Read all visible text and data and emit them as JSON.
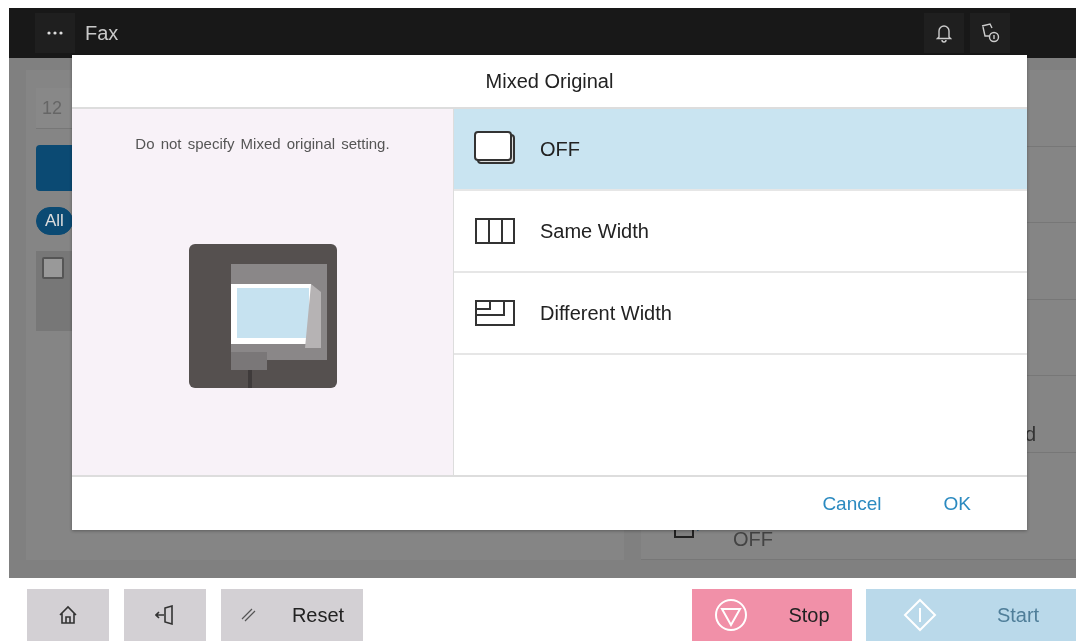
{
  "top_bar": {
    "title": "Fax"
  },
  "background": {
    "address_field": {
      "value": "12"
    },
    "filter_chip": {
      "label": "All",
      "selected": true
    },
    "list_checkbox": {
      "checked": false
    },
    "setting_tail": {
      "text": "d"
    },
    "setting_value": {
      "text": "OFF"
    }
  },
  "dialog": {
    "title": "Mixed Original",
    "description": "Do not specify Mixed original setting.",
    "options": [
      {
        "kind": "off",
        "label": "OFF",
        "selected": true
      },
      {
        "kind": "same",
        "label": "Same Width",
        "selected": false
      },
      {
        "kind": "different",
        "label": "Different Width",
        "selected": false
      }
    ],
    "buttons": [
      {
        "label": "Cancel"
      },
      {
        "label": "OK"
      }
    ]
  },
  "bottom_bar": {
    "reset": "Reset",
    "stop": "Stop",
    "start": {
      "label": "Start",
      "disabled": true
    }
  }
}
